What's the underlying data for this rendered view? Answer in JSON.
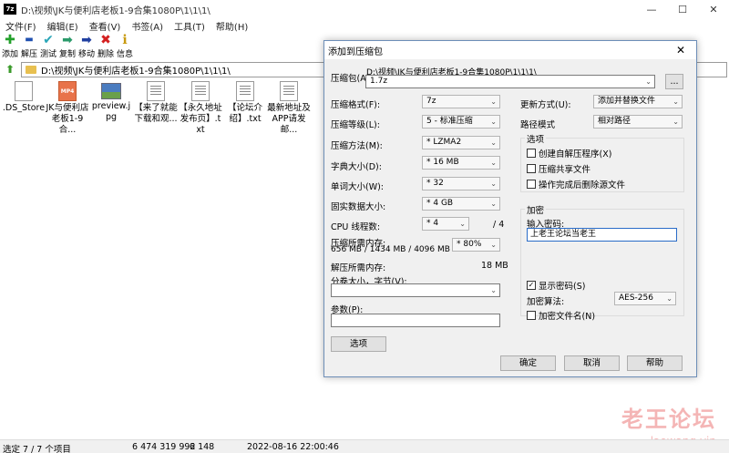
{
  "window": {
    "title": "D:\\视频\\JK与便利店老板1-9合集1080P\\1\\1\\1\\",
    "app_icon": "7z",
    "controls": {
      "minimize": "—",
      "maximize": "☐",
      "close": "✕"
    }
  },
  "menu": [
    "文件(F)",
    "编辑(E)",
    "查看(V)",
    "书签(A)",
    "工具(T)",
    "帮助(H)"
  ],
  "toolbar": [
    {
      "label": "添加",
      "icon": "plus-icon",
      "glyph": "✚",
      "color": "#22a02a"
    },
    {
      "label": "解压",
      "icon": "minus-icon",
      "glyph": "▬",
      "color": "#1f4fb0"
    },
    {
      "label": "测试",
      "icon": "check-icon",
      "glyph": "✔",
      "color": "#2aa6b8"
    },
    {
      "label": "复制",
      "icon": "copy-arrow-icon",
      "glyph": "➡",
      "color": "#2a9a6a"
    },
    {
      "label": "移动",
      "icon": "move-arrow-icon",
      "glyph": "➡",
      "color": "#1f3fa0"
    },
    {
      "label": "删除",
      "icon": "delete-x-icon",
      "glyph": "✖",
      "color": "#d42020"
    },
    {
      "label": "信息",
      "icon": "info-icon",
      "glyph": "ℹ",
      "color": "#c89a10"
    }
  ],
  "address": {
    "path": "D:\\视频\\JK与便利店老板1-9合集1080P\\1\\1\\1\\"
  },
  "files": [
    {
      "name": ".DS_Store",
      "kind": "blank"
    },
    {
      "name": "JK与便利店老板1-9合...",
      "kind": "mp4",
      "badge": "MP4"
    },
    {
      "name": "preview.jpg",
      "kind": "img"
    },
    {
      "name": "【来了就能下载和观...",
      "kind": "txt"
    },
    {
      "name": "【永久地址发布页】.txt",
      "kind": "txt"
    },
    {
      "name": "【论坛介绍】.txt",
      "kind": "txt"
    },
    {
      "name": "最新地址及APP请发邮...",
      "kind": "txt"
    }
  ],
  "status": {
    "selected": "选定 7 / 7 个项目",
    "total_size": "6 474 319 992",
    "selected_size": "6 148",
    "modified": "2022-08-16 22:00:46"
  },
  "watermark": {
    "text": "老王论坛",
    "url": "laowang.vip"
  },
  "dialog": {
    "title": "添加到压缩包",
    "close": "✕",
    "archive_label": "压缩包(A):",
    "archive_path": "D:\\视频\\JK与便利店老板1-9合集1080P\\1\\1\\1\\",
    "archive_name": "1.7z",
    "browse": "...",
    "format_label": "压缩格式(F):",
    "format_value": "7z",
    "level_label": "压缩等级(L):",
    "level_value": "5 - 标准压缩",
    "method_label": "压缩方法(M):",
    "method_value": "* LZMA2",
    "dict_label": "字典大小(D):",
    "dict_value": "* 16 MB",
    "word_label": "单词大小(W):",
    "word_value": "* 32",
    "solid_label": "固实数据大小:",
    "solid_value": "* 4 GB",
    "cpu_label": "CPU 线程数:",
    "cpu_value": "* 4",
    "cpu_total": "/ 4",
    "mem_comp_label": "压缩所需内存:",
    "mem_comp_detail": "656 MB / 1434 MB / 4096 MB",
    "mem_comp_value": "* 80%",
    "mem_decomp_label": "解压所需内存:",
    "mem_decomp_value": "18 MB",
    "split_label": "分卷大小，字节(V):",
    "split_value": "",
    "params_label": "参数(P):",
    "params_value": "",
    "options_button": "选项",
    "update_label": "更新方式(U):",
    "update_value": "添加并替换文件",
    "path_label": "路径模式",
    "path_value": "相对路径",
    "options_group": "选项",
    "opt_sfx": "创建自解压程序(X)",
    "opt_shared": "压缩共享文件",
    "opt_delete": "操作完成后删除源文件",
    "encrypt_group": "加密",
    "password_label": "输入密码:",
    "password_value": "上老王论坛当老王",
    "show_password": "显示密码(S)",
    "encrypt_method_label": "加密算法:",
    "encrypt_method_value": "AES-256",
    "encrypt_names": "加密文件名(N)",
    "ok": "确定",
    "cancel": "取消",
    "help": "帮助"
  }
}
